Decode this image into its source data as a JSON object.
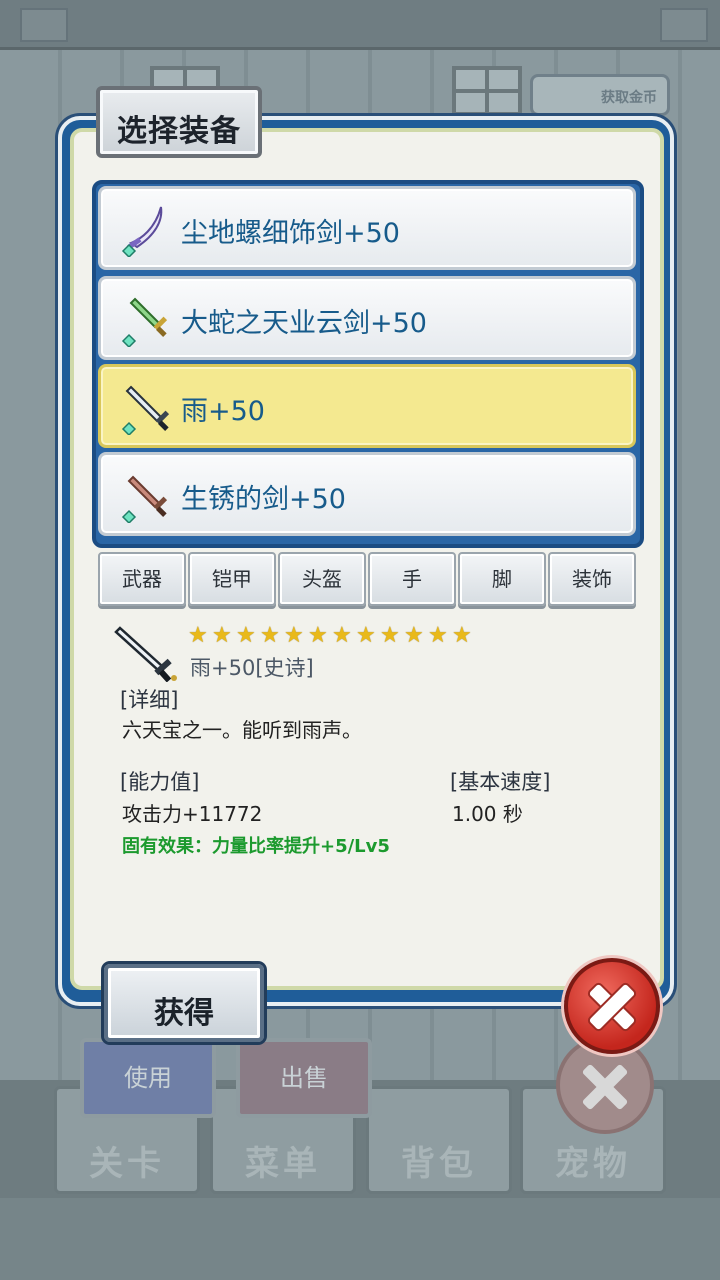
{
  "dialog": {
    "title": "选择装备",
    "items": [
      {
        "label": "尘地螺细饰剑+50",
        "icon": "curved-sword-icon",
        "selected": false
      },
      {
        "label": "大蛇之天业云剑+50",
        "icon": "green-sword-icon",
        "selected": false
      },
      {
        "label": "雨+50",
        "icon": "silver-sword-icon",
        "selected": true
      },
      {
        "label": "生锈的剑+50",
        "icon": "rusty-sword-icon",
        "selected": false
      }
    ],
    "categories": [
      "武器",
      "铠甲",
      "头盔",
      "手",
      "脚",
      "装饰"
    ],
    "detail": {
      "star_count": 12,
      "name": "雨+50[史诗]",
      "detail_heading": "[详细]",
      "description": "六天宝之一。能听到雨声。",
      "ability_heading": "[能力值]",
      "ability_value": "攻击力+11772",
      "speed_heading": "[基本速度]",
      "speed_value": "1.00 秒",
      "effect": "固有效果：力量比率提升+5/Lv5"
    },
    "obtain_label": "获得"
  },
  "background": {
    "use_label": "使用",
    "sell_label": "出售",
    "nav_tabs": [
      "关卡",
      "菜单",
      "背包",
      "宠物"
    ],
    "gold_button": "获取金币"
  },
  "colors": {
    "frame_blue": "#1f5d99",
    "selected_row": "#f4e990",
    "item_text": "#175b8b",
    "effect_green": "#1c9a2e",
    "close_red": "#c4261d"
  }
}
